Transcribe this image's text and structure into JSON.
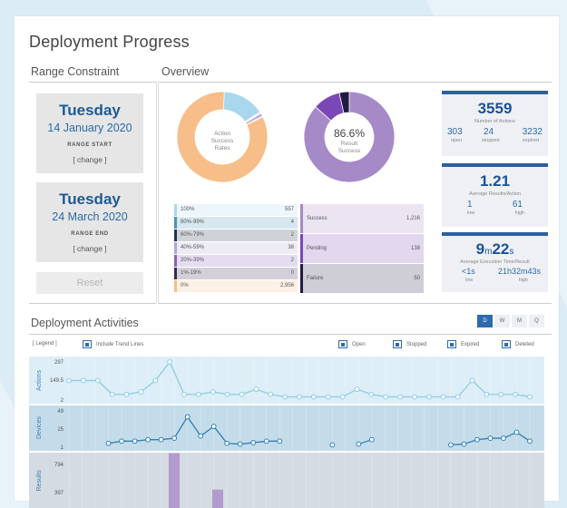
{
  "title": "Deployment Progress",
  "range": {
    "heading": "Range Constraint",
    "start": {
      "day": "Tuesday",
      "date": "14 January 2020",
      "label": "RANGE START",
      "change": "[ change ]"
    },
    "end": {
      "day": "Tuesday",
      "date": "24 March 2020",
      "label": "RANGE END",
      "change": "[ change ]"
    },
    "reset": "Reset"
  },
  "overview": {
    "heading": "Overview",
    "pie1": {
      "center_line1": "Action",
      "center_line2": "Success",
      "center_line3": "Rates",
      "slices": [
        {
          "label": "100%",
          "value": 557,
          "color": "#a9d8ee"
        },
        {
          "label": "80%-99%",
          "value": 4,
          "color": "#4a93b4"
        },
        {
          "label": "60%-79%",
          "value": 2,
          "color": "#24354f"
        },
        {
          "label": "40%-59%",
          "value": 38,
          "color": "#b4a5d2"
        },
        {
          "label": "20%-39%",
          "value": 2,
          "color": "#8b64b4"
        },
        {
          "label": "1%-19%",
          "value": 0,
          "color": "#3a2a50"
        },
        {
          "label": "0%",
          "value": 2956,
          "color": "#f7be8a"
        }
      ]
    },
    "pie2": {
      "percent": "86.6%",
      "center_line1": "Result",
      "center_line2": "Success",
      "slices": [
        {
          "label": "Success",
          "value": 1216,
          "value_text": "1,216",
          "color": "#a68ac8"
        },
        {
          "label": "Pending",
          "value": 138,
          "value_text": "138",
          "color": "#7a48b6"
        },
        {
          "label": "Failure",
          "value": 50,
          "value_text": "50",
          "color": "#231a44"
        }
      ]
    },
    "table1_values": [
      "557",
      "4",
      "2",
      "38",
      "2",
      "0",
      "2,956"
    ],
    "kpis": {
      "actions": {
        "value": "3559",
        "label": "Number of Actions",
        "open": "303",
        "open_label": "open",
        "stopped": "24",
        "stopped_label": "stopped",
        "expired": "3232",
        "expired_label": "expired"
      },
      "results": {
        "value": "1.21",
        "label": "Average Results/Action",
        "low": "1",
        "low_label": "low",
        "high": "61",
        "high_label": "high"
      },
      "time": {
        "value_m": "9",
        "unit_m": "m",
        "value_s": "22",
        "unit_s": "s",
        "label": "Average Execution Time/Result",
        "low": "<1s",
        "low_label": "low",
        "high": "21h32m43s",
        "high_label": "high"
      }
    }
  },
  "activities": {
    "heading": "Deployment Activities",
    "toggles": [
      "D",
      "W",
      "M",
      "Q"
    ],
    "active_toggle": "D",
    "legend_link": "[ Legend ]",
    "trend_label": "Include Trend Lines",
    "filters": [
      "Open",
      "Stopped",
      "Expired",
      "Deleted"
    ],
    "rows": [
      {
        "name": "Actions",
        "ticks": [
          "297",
          "149.5",
          "2"
        ],
        "bg": "#ddeef7"
      },
      {
        "name": "Devices",
        "ticks": [
          "49",
          "25",
          "1"
        ],
        "bg": "#c4dcea"
      },
      {
        "name": "Results",
        "ticks": [
          "794",
          "397"
        ],
        "bg": "#d4dbe3"
      }
    ]
  },
  "chart_data": [
    {
      "type": "line",
      "name": "Actions",
      "ylim": [
        2,
        297
      ],
      "values": [
        149.5,
        149.5,
        149.5,
        40,
        40,
        60,
        149.5,
        297,
        40,
        40,
        60,
        40,
        40,
        80,
        40,
        20,
        20,
        20,
        20,
        20,
        80,
        40,
        20,
        20,
        20,
        20,
        20,
        20,
        149.5,
        40,
        40,
        40,
        20
      ]
    },
    {
      "type": "line",
      "name": "Devices",
      "ylim": [
        1,
        49
      ],
      "values": [
        null,
        null,
        null,
        5,
        8,
        8,
        10,
        10,
        12,
        41,
        15,
        28,
        5,
        4,
        6,
        8,
        8,
        null,
        null,
        null,
        3,
        null,
        4,
        10,
        null,
        null,
        null,
        null,
        null,
        3,
        4,
        10,
        12,
        12,
        20,
        8
      ]
    },
    {
      "type": "bar",
      "name": "Results",
      "ylim": [
        0,
        794
      ],
      "values": [
        0,
        0,
        0,
        0,
        0,
        0,
        0,
        794,
        0,
        0,
        60
      ]
    }
  ]
}
